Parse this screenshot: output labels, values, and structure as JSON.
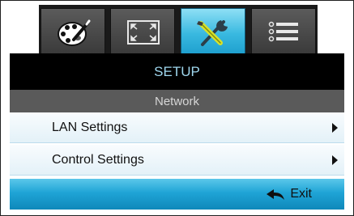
{
  "tabs": [
    {
      "icon": "palette-icon",
      "active": false
    },
    {
      "icon": "fullscreen-icon",
      "active": false
    },
    {
      "icon": "tools-icon",
      "active": true
    },
    {
      "icon": "list-icon",
      "active": false
    }
  ],
  "menu": {
    "title": "SETUP",
    "subtitle": "Network",
    "items": [
      {
        "label": "LAN Settings"
      },
      {
        "label": "Control Settings"
      }
    ],
    "exit_label": "Exit"
  },
  "colors": {
    "active_tab": "#39b9e0",
    "title_text": "#9fd7ee",
    "exit_bar": "#1fa4d6"
  }
}
